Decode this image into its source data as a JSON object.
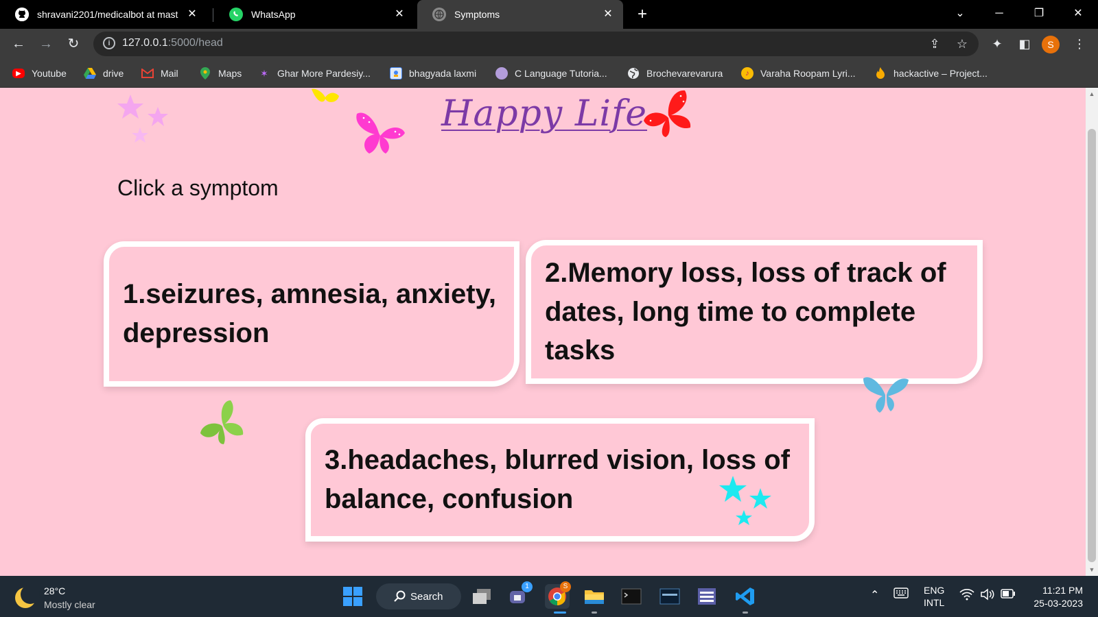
{
  "browser": {
    "tabs": [
      {
        "title": "shravani2201/medicalbot at mast",
        "favicon": "github-icon",
        "active": false
      },
      {
        "title": "WhatsApp",
        "favicon": "whatsapp-icon",
        "active": false
      },
      {
        "title": "Symptoms",
        "favicon": "globe-icon",
        "active": true
      }
    ],
    "url_host": "127.0.0.1",
    "url_path": ":5000/head",
    "profile_initial": "S",
    "bookmarks": [
      {
        "label": "Youtube",
        "icon": "youtube-icon",
        "color": "#ff0000"
      },
      {
        "label": "drive",
        "icon": "drive-icon",
        "color": "#34a853"
      },
      {
        "label": "Mail",
        "icon": "gmail-icon",
        "color": "#ea4335"
      },
      {
        "label": "Maps",
        "icon": "maps-icon",
        "color": "#34a853"
      },
      {
        "label": "Ghar More Pardesiy...",
        "icon": "sparkle-icon",
        "color": "#a142f4"
      },
      {
        "label": "bhagyada laxmi",
        "icon": "image-icon",
        "color": "#4285f4"
      },
      {
        "label": "C Language Tutoria...",
        "icon": "avatar-icon",
        "color": "#9e9e9e"
      },
      {
        "label": "Brochevarevarura",
        "icon": "globe-icon",
        "color": "#e8eaed"
      },
      {
        "label": "Varaha Roopam Lyri...",
        "icon": "music-icon",
        "color": "#fbbc04"
      },
      {
        "label": "hackactive – Project...",
        "icon": "flame-icon",
        "color": "#f9ab00"
      }
    ]
  },
  "page": {
    "brand": "Happy Life",
    "prompt": "Click a symptom",
    "symptoms": [
      "1.seizures, amnesia, anxiety, depression",
      "2.Memory loss, loss of track of dates, long time to complete tasks",
      "3.headaches, blurred vision, loss of balance, confusion"
    ]
  },
  "taskbar": {
    "temperature": "28°C",
    "weather": "Mostly clear",
    "search_label": "Search",
    "teams_badge": "1",
    "chrome_badge": "S",
    "lang_top": "ENG",
    "lang_bottom": "INTL",
    "time": "11:21 PM",
    "date": "25-03-2023"
  }
}
